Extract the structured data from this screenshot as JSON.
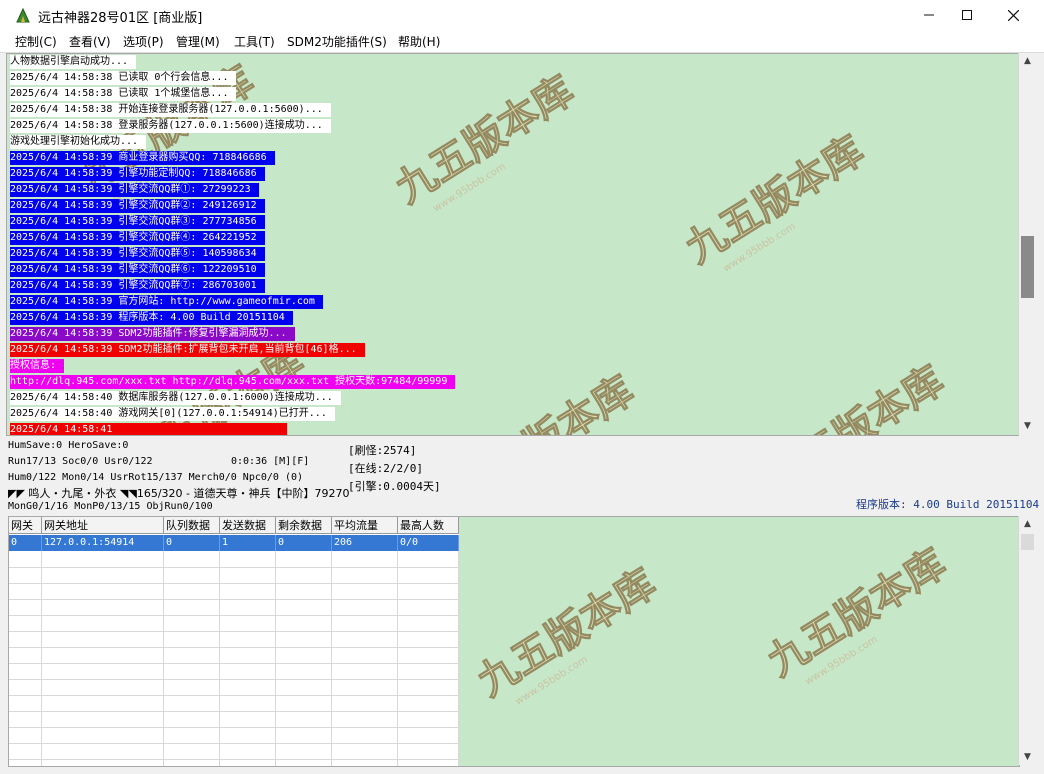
{
  "window": {
    "title": "远古神器28号01区 [商业版]"
  },
  "menu": [
    "控制(C)",
    "查看(V)",
    "选项(P)",
    "管理(M)",
    "工具(T)",
    "SDM2功能插件(S)",
    "帮助(H)"
  ],
  "log": [
    {
      "text": "人物数据引擎启动成功...",
      "fg": "#000000",
      "bg": "#ffffff"
    },
    {
      "text": "2025/6/4 14:58:38 已读取 0个行会信息...",
      "fg": "#000000",
      "bg": "#ffffff"
    },
    {
      "text": "2025/6/4 14:58:38 已读取 1个城堡信息...",
      "fg": "#000000",
      "bg": "#ffffff"
    },
    {
      "text": "2025/6/4 14:58:38 开始连接登录服务器(127.0.0.1:5600)...",
      "fg": "#000000",
      "bg": "#ffffff"
    },
    {
      "text": "2025/6/4 14:58:38 登录服务器(127.0.0.1:5600)连接成功...",
      "fg": "#000000",
      "bg": "#ffffff"
    },
    {
      "text": "游戏处理引擎初始化成功...",
      "fg": "#000000",
      "bg": "#ffffff"
    },
    {
      "text": "2025/6/4 14:58:39 商业登录器购买QQ: 718846686",
      "fg": "#ffffff",
      "bg": "#0000f0"
    },
    {
      "text": "2025/6/4 14:58:39 引擎功能定制QQ: 718846686",
      "fg": "#ffffff",
      "bg": "#0000f0"
    },
    {
      "text": "2025/6/4 14:58:39 引擎交流QQ群①: 27299223",
      "fg": "#ffffff",
      "bg": "#0000f0"
    },
    {
      "text": "2025/6/4 14:58:39 引擎交流QQ群②: 249126912",
      "fg": "#ffffff",
      "bg": "#0000f0"
    },
    {
      "text": "2025/6/4 14:58:39 引擎交流QQ群③: 277734856",
      "fg": "#ffffff",
      "bg": "#0000f0"
    },
    {
      "text": "2025/6/4 14:58:39 引擎交流QQ群④: 264221952",
      "fg": "#ffffff",
      "bg": "#0000f0"
    },
    {
      "text": "2025/6/4 14:58:39 引擎交流QQ群⑤: 140598634",
      "fg": "#ffffff",
      "bg": "#0000f0"
    },
    {
      "text": "2025/6/4 14:58:39 引擎交流QQ群⑥: 122209510",
      "fg": "#ffffff",
      "bg": "#0000f0"
    },
    {
      "text": "2025/6/4 14:58:39 引擎交流QQ群⑦: 286703001",
      "fg": "#ffffff",
      "bg": "#0000f0"
    },
    {
      "text": "2025/6/4 14:58:39 官方网站: http://www.gameofmir.com",
      "fg": "#ffffff",
      "bg": "#0000f0"
    },
    {
      "text": "2025/6/4 14:58:39 程序版本: 4.00 Build 20151104",
      "fg": "#ffffff",
      "bg": "#0000f0"
    },
    {
      "text": "2025/6/4 14:58:39 SDM2功能插件:修复引擎漏洞成功...",
      "fg": "#ffffff",
      "bg": "#8a08c8"
    },
    {
      "text": "2025/6/4 14:58:39 SDM2功能插件:扩展背包未开启,当前背包[46]格...",
      "fg": "#ffffff",
      "bg": "#f00000"
    },
    {
      "text": "授权信息:",
      "fg": "#ffffff",
      "bg": "#f000f0"
    },
    {
      "text": "http://dlq.945.com/xxx.txt http://dlq.945.com/xxx.txt 授权天数:97484/99999",
      "fg": "#ffffff",
      "bg": "#f000f0"
    },
    {
      "text": "2025/6/4 14:58:40 数据库服务器(127.0.0.1:6000)连接成功...",
      "fg": "#000000",
      "bg": "#ffffff"
    },
    {
      "text": "2025/6/4 14:58:40 游戏网关[0](127.0.0.1:54914)已打开...",
      "fg": "#000000",
      "bg": "#ffffff"
    },
    {
      "text": "2025/6/4 14:58:41",
      "fg": "#ffffff",
      "bg": "#f00000"
    }
  ],
  "status": {
    "humsave": "HumSave:0 HeroSave:0",
    "run": "Run17/13 Soc0/0 Usr0/122",
    "time": "0:0:36 [M][F]",
    "refresh": "[刷怪:2574]",
    "online": "[在线:2/2/0]",
    "engine": "[引擎:0.0004天]",
    "hum": "Hum0/122 Mon0/14 UsrRot15/137 Merch0/0 Npc0/0 (0)",
    "actor": "◤◤ 鸣人・九尾・外衣 ◥◥165/320 - 道德天尊・神兵【中阶】79270",
    "mon": "MonG0/1/16 MonP0/13/15 ObjRun0/100",
    "version": "程序版本: 4.00 Build 20151104"
  },
  "grid": {
    "headers": [
      "网关",
      "网关地址",
      "队列数据",
      "发送数据",
      "剩余数据",
      "平均流量",
      "最高人数"
    ],
    "rows": [
      [
        "0",
        "127.0.0.1:54914",
        "0",
        "1",
        "0",
        "206",
        "0/0"
      ]
    ]
  },
  "watermark": {
    "text": "九五版本库",
    "url": "www.95bbb.com"
  },
  "colors": {
    "log_bg": "#c7e8c8",
    "selection": "#3478d4"
  }
}
